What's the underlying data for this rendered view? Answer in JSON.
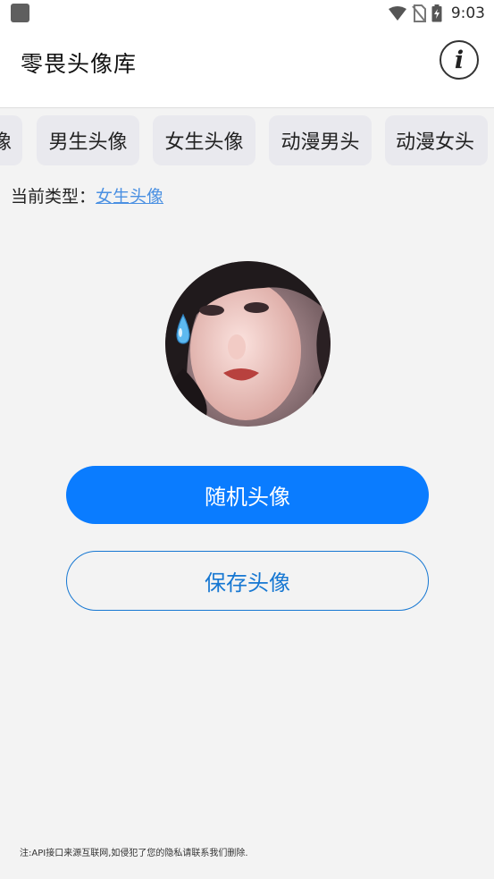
{
  "status_bar": {
    "time": "9:03",
    "icons": [
      "app-notification-icon",
      "wifi-icon",
      "no-sim-icon",
      "battery-charging-icon"
    ]
  },
  "app_bar": {
    "title": "零畏头像库",
    "info_icon": "info-icon"
  },
  "tabs": [
    {
      "label": "像"
    },
    {
      "label": "男生头像"
    },
    {
      "label": "女生头像"
    },
    {
      "label": "动漫男头"
    },
    {
      "label": "动漫女头"
    }
  ],
  "current_type": {
    "label": "当前类型：",
    "value": "女生头像"
  },
  "avatar": {
    "emoji": "💧"
  },
  "buttons": {
    "random_label": "随机头像",
    "save_label": "保存头像"
  },
  "footer": {
    "note": "注:API接口来源互联网,如侵犯了您的隐私请联系我们删除."
  },
  "colors": {
    "primary": "#0a7cff",
    "outline": "#1677d2",
    "link": "#4a90e2",
    "background": "#f3f3f3"
  }
}
